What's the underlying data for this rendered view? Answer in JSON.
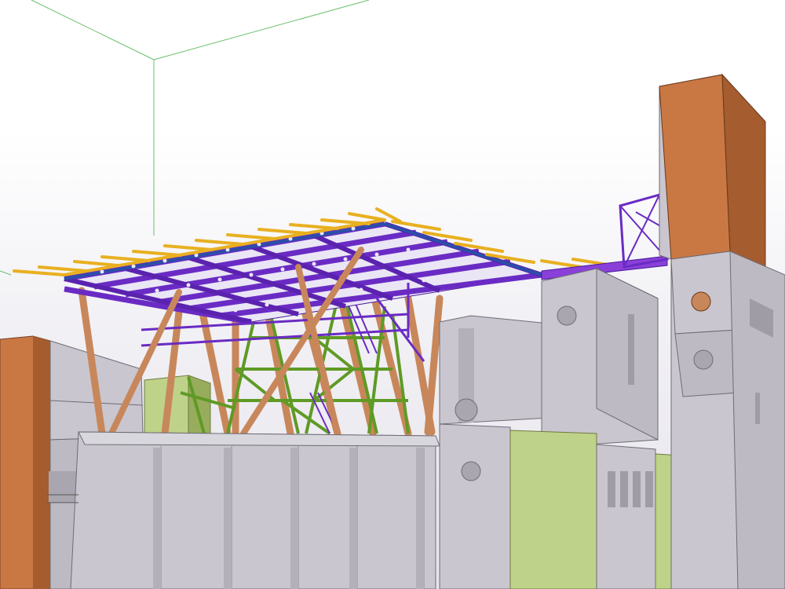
{
  "viewport": {
    "label": "",
    "background_top": "#ffffff",
    "background_bottom": "#e6e4ec"
  },
  "scene": {
    "description_hidden": false,
    "colors": {
      "steel_purple": "#6a2bc4",
      "steel_purple_dark": "#4a1a9a",
      "steel_blue": "#2a4fa8",
      "purlin_yellow": "#e8b020",
      "column_orange": "#c8875a",
      "column_orange_dark": "#9a5f38",
      "bracing_green": "#7cc23a",
      "bracing_green_dark": "#4f8a1f",
      "concrete_grey": "#c9c6cf",
      "concrete_grey_dark": "#9f9ca6",
      "concrete_grey_light": "#d9d7de",
      "block_green": "#bfd28a",
      "block_green_dark": "#97ad5c",
      "wall_orange": "#c97844",
      "wall_orange_dark": "#a55c2e",
      "bounding_box": "#6bbf6b"
    }
  }
}
